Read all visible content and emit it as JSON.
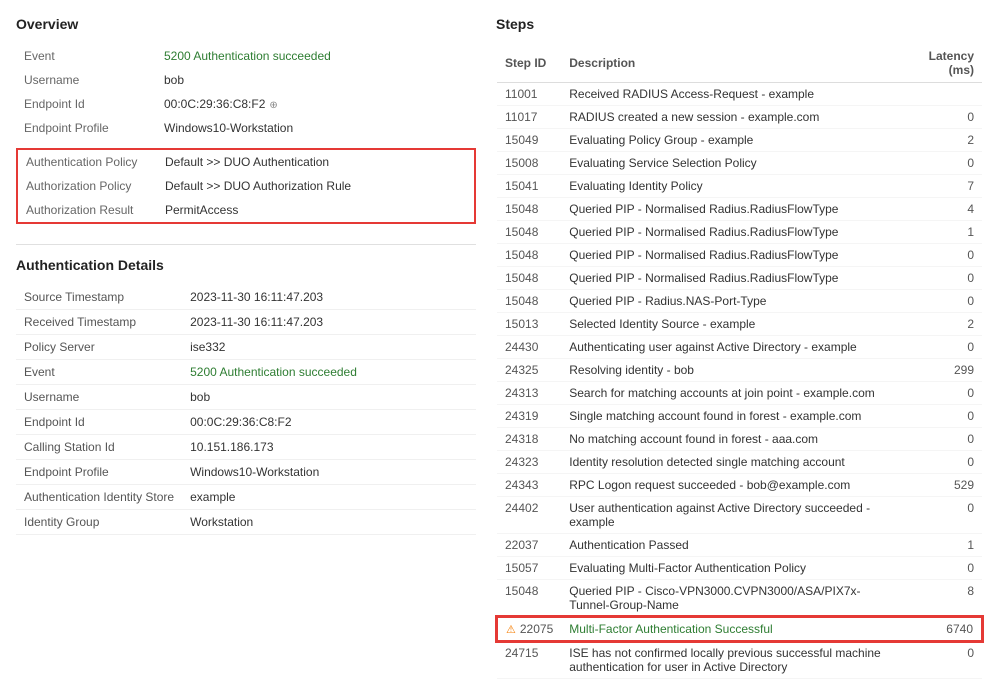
{
  "overview": {
    "title": "Overview",
    "fields": [
      {
        "label": "Event",
        "value": "5200 Authentication succeeded",
        "isLink": true
      },
      {
        "label": "Username",
        "value": "bob",
        "isLink": false
      },
      {
        "label": "Endpoint Id",
        "value": "00:0C:29:36:C8:F2",
        "hasCopy": true,
        "isLink": false
      },
      {
        "label": "Endpoint Profile",
        "value": "Windows10-Workstation",
        "isLink": false
      }
    ],
    "highlighted_fields": [
      {
        "label": "Authentication Policy",
        "value": "Default >> DUO Authentication",
        "isLink": false
      },
      {
        "label": "Authorization Policy",
        "value": "Default >> DUO Authorization Rule",
        "isLink": false
      },
      {
        "label": "Authorization Result",
        "value": "PermitAccess",
        "isLink": false
      }
    ]
  },
  "auth_details": {
    "title": "Authentication Details",
    "fields": [
      {
        "label": "Source Timestamp",
        "value": "2023-11-30 16:11:47.203"
      },
      {
        "label": "Received Timestamp",
        "value": "2023-11-30 16:11:47.203"
      },
      {
        "label": "Policy Server",
        "value": "ise332"
      },
      {
        "label": "Event",
        "value": "5200 Authentication succeeded",
        "isLink": true
      },
      {
        "label": "Username",
        "value": "bob"
      },
      {
        "label": "Endpoint Id",
        "value": "00:0C:29:36:C8:F2"
      },
      {
        "label": "Calling Station Id",
        "value": "10.151.186.173"
      },
      {
        "label": "Endpoint Profile",
        "value": "Windows10-Workstation"
      },
      {
        "label": "Authentication Identity Store",
        "value": "example"
      },
      {
        "label": "Identity Group",
        "value": "Workstation"
      }
    ]
  },
  "steps": {
    "title": "Steps",
    "columns": [
      "Step ID",
      "Description",
      "Latency (ms)"
    ],
    "rows": [
      {
        "id": "11001",
        "description": "Received RADIUS Access-Request - example",
        "latency": ""
      },
      {
        "id": "11017",
        "description": "RADIUS created a new session - example.com",
        "latency": "0"
      },
      {
        "id": "15049",
        "description": "Evaluating Policy Group - example",
        "latency": "2"
      },
      {
        "id": "15008",
        "description": "Evaluating Service Selection Policy",
        "latency": "0"
      },
      {
        "id": "15041",
        "description": "Evaluating Identity Policy",
        "latency": "7"
      },
      {
        "id": "15048",
        "description": "Queried PIP - Normalised Radius.RadiusFlowType",
        "latency": "4"
      },
      {
        "id": "15048",
        "description": "Queried PIP - Normalised Radius.RadiusFlowType",
        "latency": "1"
      },
      {
        "id": "15048",
        "description": "Queried PIP - Normalised Radius.RadiusFlowType",
        "latency": "0"
      },
      {
        "id": "15048",
        "description": "Queried PIP - Normalised Radius.RadiusFlowType",
        "latency": "0"
      },
      {
        "id": "15048",
        "description": "Queried PIP - Radius.NAS-Port-Type",
        "latency": "0"
      },
      {
        "id": "15013",
        "description": "Selected Identity Source - example",
        "latency": "2"
      },
      {
        "id": "24430",
        "description": "Authenticating user against Active Directory - example",
        "latency": "0"
      },
      {
        "id": "24325",
        "description": "Resolving identity - bob",
        "latency": "299"
      },
      {
        "id": "24313",
        "description": "Search for matching accounts at join point - example.com",
        "latency": "0"
      },
      {
        "id": "24319",
        "description": "Single matching account found in forest - example.com",
        "latency": "0"
      },
      {
        "id": "24318",
        "description": "No matching account found in forest - aaa.com",
        "latency": "0"
      },
      {
        "id": "24323",
        "description": "Identity resolution detected single matching account",
        "latency": "0"
      },
      {
        "id": "24343",
        "description": "RPC Logon request succeeded - bob@example.com",
        "latency": "529"
      },
      {
        "id": "24402",
        "description": "User authentication against Active Directory succeeded - example",
        "latency": "0"
      },
      {
        "id": "22037",
        "description": "Authentication Passed",
        "latency": "1"
      },
      {
        "id": "15057",
        "description": "Evaluating Multi-Factor Authentication Policy",
        "latency": "0"
      },
      {
        "id": "15048",
        "description": "Queried PIP - Cisco-VPN3000.CVPN3000/ASA/PIX7x-Tunnel-Group-Name",
        "latency": "8"
      },
      {
        "id": "22075",
        "description": "Multi-Factor Authentication Successful",
        "latency": "6740",
        "highlighted": true,
        "isLink": true,
        "hasWarning": true
      },
      {
        "id": "24715",
        "description": "ISE has not confirmed locally previous successful machine authentication for user in Active Directory",
        "latency": "0"
      }
    ]
  }
}
